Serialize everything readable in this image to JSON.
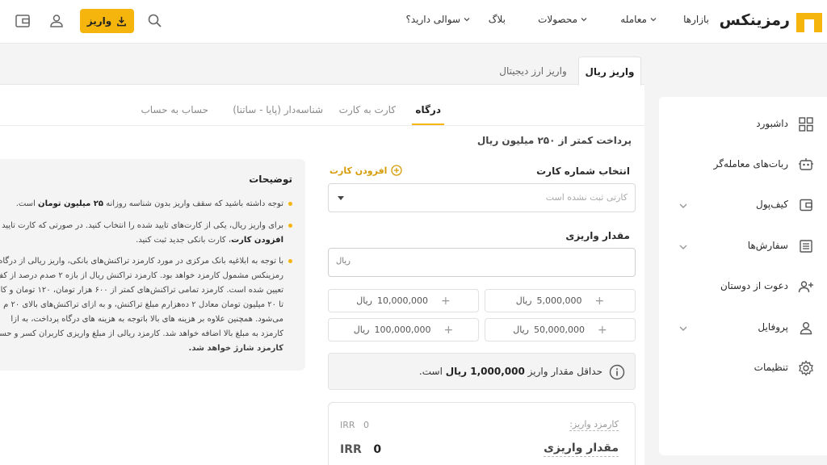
{
  "header": {
    "logo_text": "رمزینکس",
    "nav": {
      "markets": "بازارها",
      "trade": "معامله",
      "products": "محصولات",
      "blog": "بلاگ",
      "faq": "سوالی دارید؟"
    },
    "deposit_button": "واریز"
  },
  "sidebar": {
    "items": [
      {
        "label": "داشبورد",
        "icon": "dashboard-icon"
      },
      {
        "label": "ربات‌های معامله‌گر",
        "icon": "robot-icon"
      },
      {
        "label": "کیف‌پول",
        "icon": "wallet-icon"
      },
      {
        "label": "سفارش‌ها",
        "icon": "orders-icon"
      },
      {
        "label": "دعوت از دوستان",
        "icon": "invite-icon"
      },
      {
        "label": "پروفایل",
        "icon": "profile-icon"
      },
      {
        "label": "تنظیمات",
        "icon": "settings-icon"
      }
    ]
  },
  "tabs": {
    "rial": "واریز ریال",
    "crypto": "واریز ارز دیجیتال"
  },
  "subtabs": {
    "gateway": "درگاه",
    "card_to_card": "کارت به کارت",
    "id_deposit": "شناسه‌دار (پایا - ساتنا)",
    "account": "حساب به حساب"
  },
  "form": {
    "notice": "پرداخت کمتر از ۲۵۰ میلیون ریال",
    "card_label": "انتخاب شماره کارت",
    "add_card": "افزودن کارت",
    "card_placeholder": "کارتی ثبت نشده است",
    "amount_label": "مقدار واریزی",
    "amount_unit": "ریال",
    "presets": [
      "5,000,000",
      "10,000,000",
      "50,000,000",
      "100,000,000"
    ],
    "preset_unit": "ریال",
    "min_note_pre": "حداقل مقدار واریز",
    "min_note_amount": "1,000,000 ریال",
    "min_note_post": "است."
  },
  "fee": {
    "fee_label": "کارمزد واریز:",
    "fee_value": "0",
    "fee_unit": "IRR",
    "amount_label": "مقدار واریزی",
    "amount_value": "0",
    "amount_unit": "IRR"
  },
  "description": {
    "title": "توضیحات",
    "b1_pre": "توجه داشته باشید که سقف واریز بدون شناسه روزانه",
    "b1_bold": "۲۵ میلیون تومان",
    "b1_post": "است.",
    "b2_l1": "برای واریز ریال، یکی از کارت‌های تایید شده را انتخاب کنید. در صورتی که کارت تایید",
    "b2_l2_bold": "افزودن کارت",
    "b2_l2_post": "، کارت بانکی جدید ثبت کنید.",
    "b3_l1": "با توجه به ابلاغیه بانک مرکزی در مورد کارمزد تراکنش‌های بانکی، واریز ریالی از درگاه",
    "b3_l2": "رمزینکس مشمول کارمزد خواهد بود. کارمزد تراکنش ریال از بازه ۲ صدم درصد از کف",
    "b3_l3": "تعیین شده است. کارمزد تمامی تراکنش‌های کمتر از ۶۰۰ هزار تومان، ۱۲۰ تومان و کا",
    "b3_l4": "تا ۲۰ میلیون تومان معادل ۲ ده‌هزارم مبلغ تراکنش، و به ازای تراکنش‌های بالای ۲۰ م",
    "b3_l5": "می‌شود. همچنین علاوه بر هزینه های بالا باتوجه به هزینه های درگاه پرداخت، به ازا",
    "b3_l6": "کارمزد به مبلغ بالا اضافه خواهد شد. کارمزد ریالی از مبلغ واریزی کاربران کسر و حساب",
    "b3_l7": "کارمزد شارژ خواهد شد."
  },
  "colors": {
    "accent": "#f6b50c",
    "text": "#2b2b2b",
    "muted": "#8a8a8e"
  }
}
